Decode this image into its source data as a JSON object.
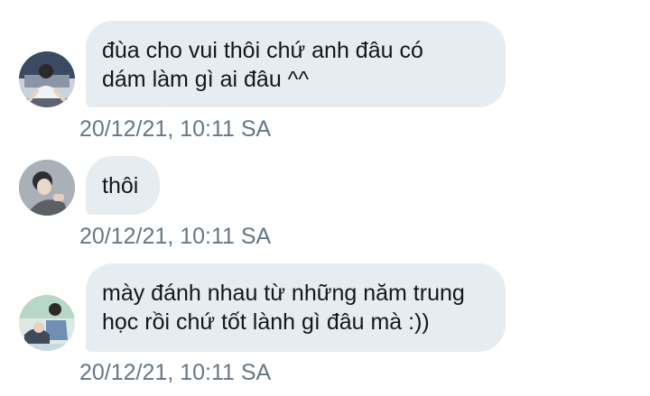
{
  "messages": [
    {
      "lines": [
        "đùa cho vui thôi chứ anh đâu có",
        "dám làm gì ai đâu ^^"
      ],
      "timestamp": "20/12/21, 10:11 SA"
    },
    {
      "lines": [
        "thôi"
      ],
      "timestamp": "20/12/21, 10:11 SA"
    },
    {
      "lines": [
        "mày đánh nhau từ những năm trung",
        "học rồi chứ tốt lành gì đâu mà :))"
      ],
      "timestamp": "20/12/21, 10:11 SA"
    }
  ],
  "colors": {
    "bubble": "#e6ecf0",
    "text": "#14171a",
    "timestamp": "#657786"
  }
}
